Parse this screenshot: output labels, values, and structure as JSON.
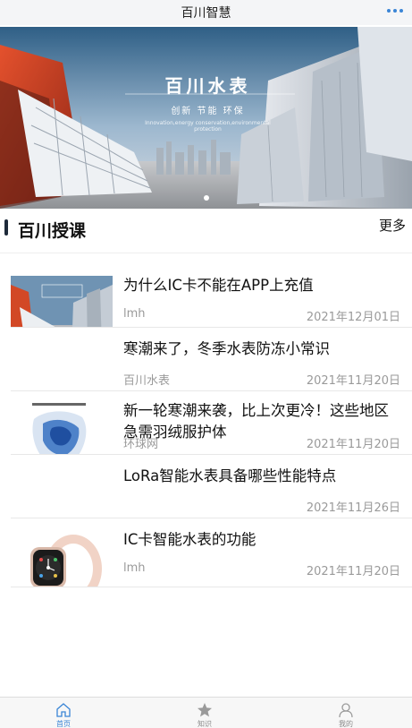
{
  "app": {
    "title": "百川智慧"
  },
  "banner": {
    "title": "百川水表",
    "subtitle": "创新  节能  环保",
    "english": "Innovation,energy conservation,environmental protection"
  },
  "section": {
    "title": "百川授课",
    "more_label": "更多"
  },
  "articles": [
    {
      "title": "为什么IC卡不能在APP上充值",
      "author": "lmh",
      "date": "2021年12月01日",
      "thumb": "building-banner-icon"
    },
    {
      "title": "寒潮来了，冬季水表防冻小常识",
      "author": "百川水表",
      "date": "2021年11月20日",
      "thumb": ""
    },
    {
      "title": "新一轮寒潮来袭，比上次更冷！这些地区急需羽绒服护体",
      "author": "环球网",
      "date": "2021年11月20日",
      "thumb": "weather-map-icon"
    },
    {
      "title": "LoRa智能水表具备哪些性能特点",
      "author": "",
      "date": "2021年11月26日",
      "thumb": ""
    },
    {
      "title": "IC卡智能水表的功能",
      "author": "lmh",
      "date": "2021年11月20日",
      "thumb": "smartwatch-icon"
    }
  ],
  "tabs": [
    {
      "label": "首页",
      "icon": "home-icon",
      "active": true
    },
    {
      "label": "知识",
      "icon": "star-icon",
      "active": false
    },
    {
      "label": "我的",
      "icon": "user-icon",
      "active": false
    }
  ],
  "colors": {
    "accent": "#3a85d6",
    "section_bar": "#1e2a3a",
    "muted_text": "#9a9a9a"
  }
}
